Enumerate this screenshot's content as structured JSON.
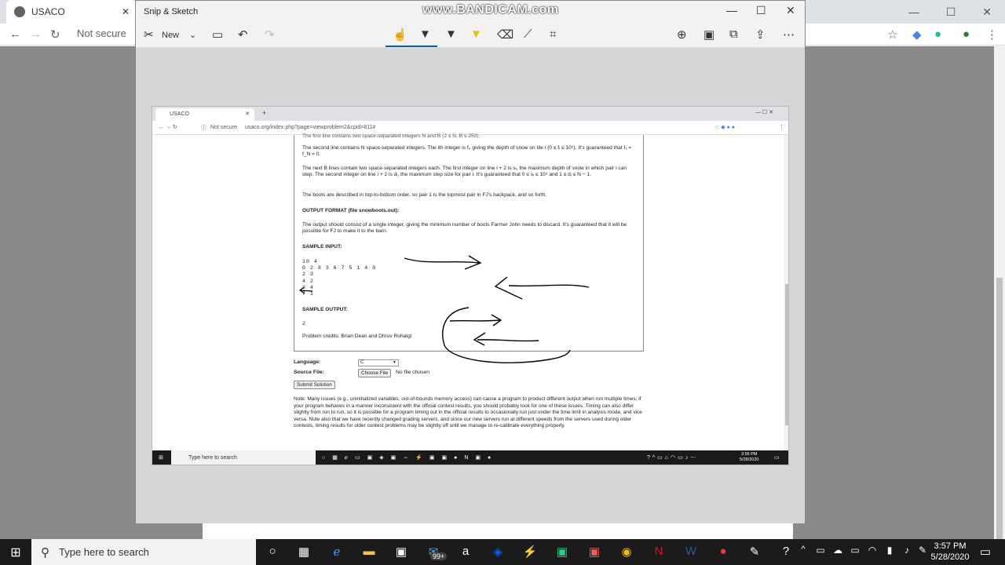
{
  "background_browser": {
    "tab_title": "USACO",
    "address_text": "Not secure"
  },
  "snip": {
    "title": "Snip & Sketch",
    "new_label": "New",
    "watermark": "www.BANDICAM.com"
  },
  "inner": {
    "tab_title": "USACO",
    "not_secure": "Not secure",
    "url": "usaco.org/index.php?page=viewproblem2&cpid=811#",
    "cut_line": "The first line contains two space-separated integers N and B (2 ≤ N, B ≤ 250).",
    "para1": "The second line contains N space-separated integers. The ith integer is fᵢ, giving the depth of snow on tile i (0 ≤ fᵢ ≤ 10⁹). It's guaranteed that f₁ = f_N = 0.",
    "para2": "The next B lines contain two space-separated integers each. The first integer on line i + 2 is sᵢ, the maximum depth of snow in which pair i can step. The second integer on line i + 2 is dᵢ, the maximum step size for pair i. It's guaranteed that 0 ≤ sᵢ ≤ 10⁹ and 1 ≤ dᵢ ≤ N − 1.",
    "para3": "The boots are described in top-to-bottom order, so pair 1 is the topmost pair in FJ's backpack, and so forth.",
    "output_format_heading": "OUTPUT FORMAT (file snowboots.out):",
    "output_para": "The output should consist of a single integer, giving the minimum number of boots Farmer John needs to discard. It's guaranteed that it will be possible for FJ to make it to the barn.",
    "sample_input_heading": "SAMPLE INPUT:",
    "sample_input": [
      "10 4",
      "0 2 8 3 6 7 5 1 4 0",
      "2 3",
      "4 2",
      "3 4",
      "7 1"
    ],
    "sample_output_heading": "SAMPLE OUTPUT:",
    "sample_output": "2",
    "credits": "Problem credits: Brian Dean and Dhruv Rohatgi",
    "language_label": "Language:",
    "language_value": "C",
    "source_label": "Source File:",
    "choose_file": "Choose File",
    "no_file": "No file chosen",
    "submit": "Submit Solution",
    "note": "Note: Many issues (e.g., uninitialized variables, out-of-bounds memory access) can cause a program to product different output when run multiple times; if your program behaves in a manner inconsistent with the official contest results, you should probably look for one of these issues. Timing can also differ slightly from run to run, so it is possible for a program timing out in the official results to occasionally run just under the time limit in analysis mode, and vice versa. Note also that we have recently changed grading servers, and since our new servers run at different speeds from the servers used during older contests, timing results for older contest problems may be slightly off until we manage to re-calibrate everything properly.",
    "taskbar_search": "Type here to search",
    "taskbar_time": "3:56 PM",
    "taskbar_date": "5/28/2020"
  },
  "taskbar": {
    "search_placeholder": "Type here to search",
    "time": "3:57 PM",
    "date": "5/28/2020",
    "badge": "99+"
  }
}
